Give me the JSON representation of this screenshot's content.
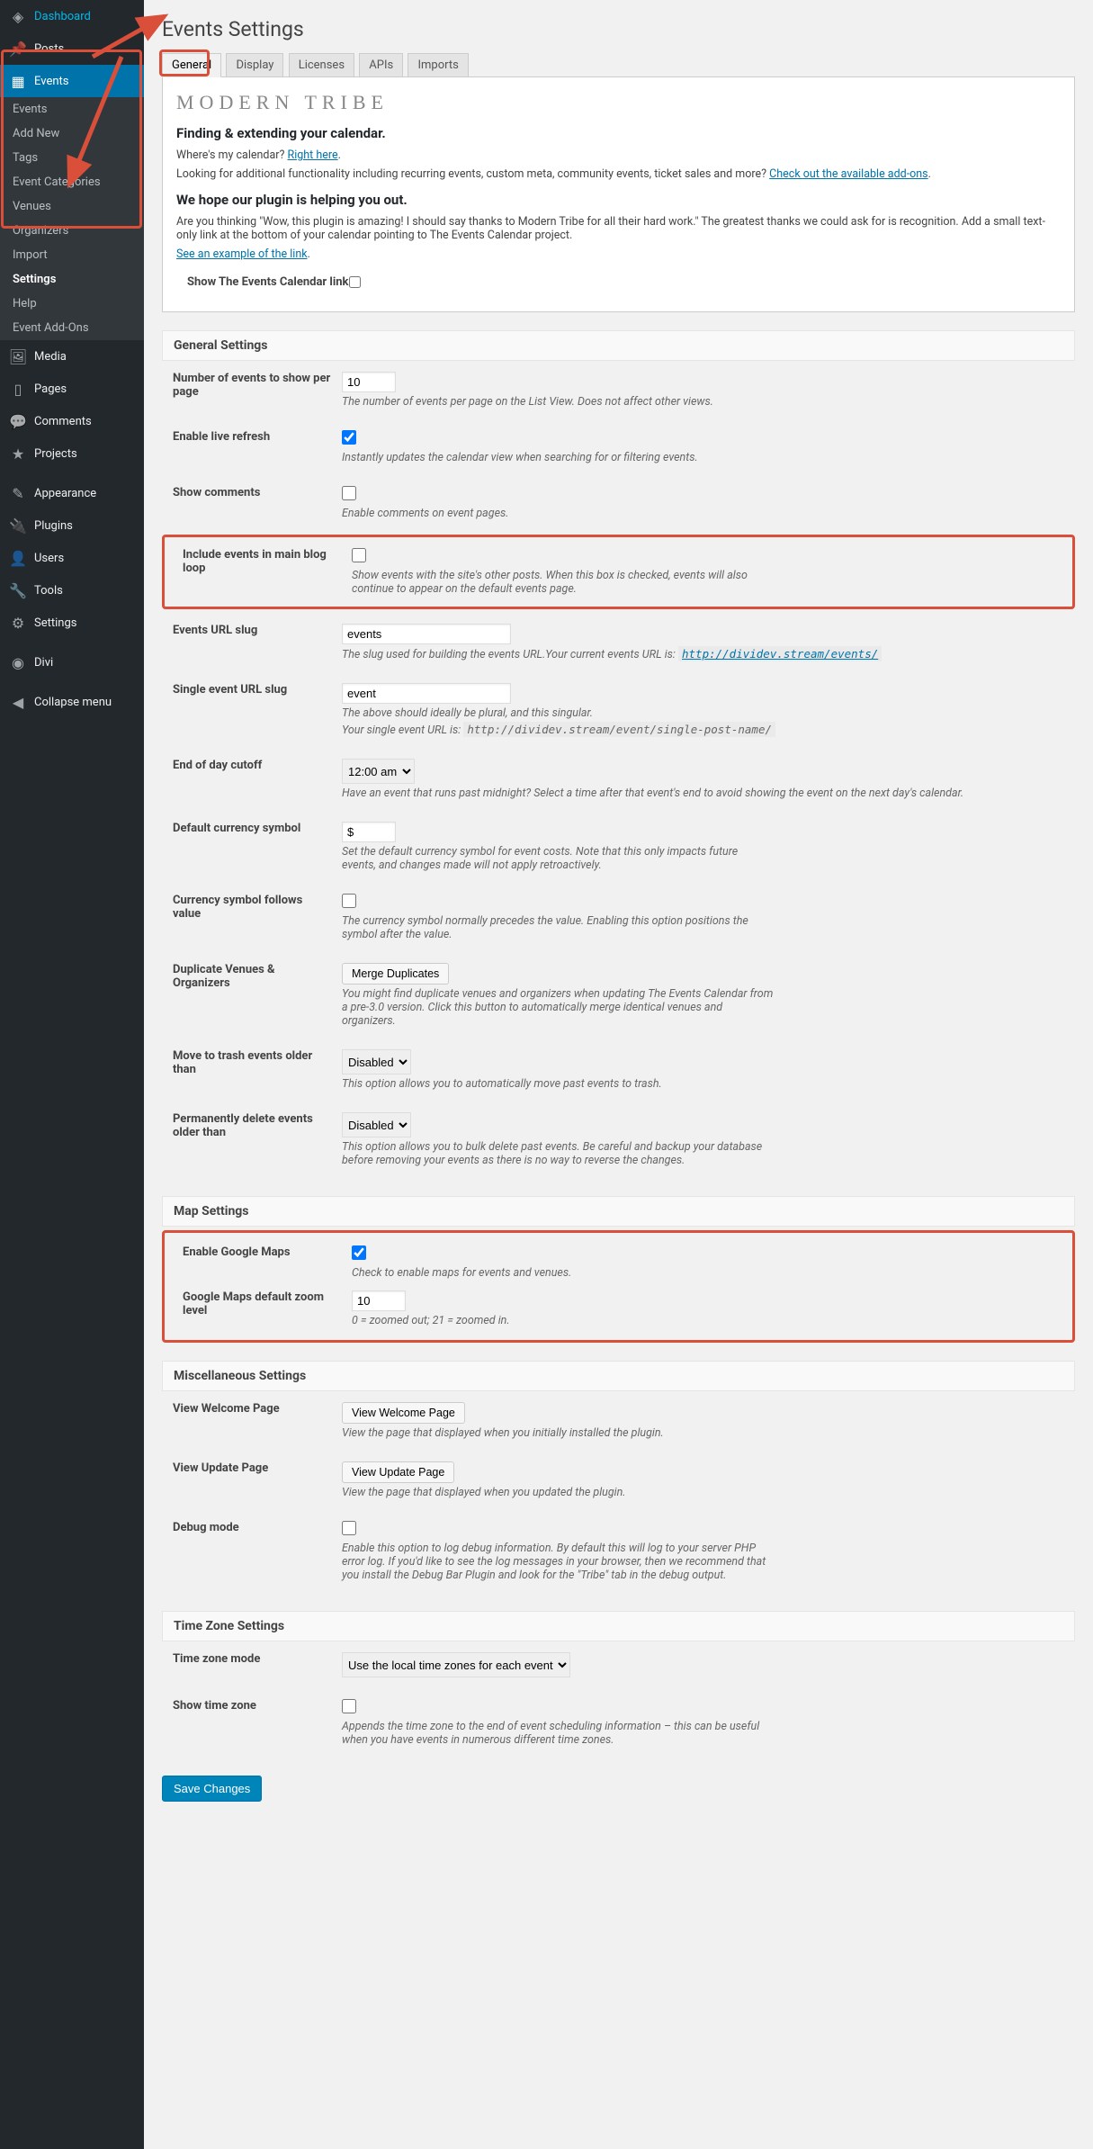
{
  "sidebar": {
    "items": [
      {
        "label": "Dashboard",
        "icon": "◈"
      },
      {
        "label": "Posts",
        "icon": "📌"
      },
      {
        "label": "Events",
        "icon": "▦",
        "active": true
      },
      {
        "label": "Media",
        "icon": "🖼"
      },
      {
        "label": "Pages",
        "icon": "▯"
      },
      {
        "label": "Comments",
        "icon": "💬"
      },
      {
        "label": "Projects",
        "icon": "★"
      },
      {
        "label": "Appearance",
        "icon": "✎"
      },
      {
        "label": "Plugins",
        "icon": "🔌"
      },
      {
        "label": "Users",
        "icon": "👤"
      },
      {
        "label": "Tools",
        "icon": "🔧"
      },
      {
        "label": "Settings",
        "icon": "⚙"
      },
      {
        "label": "Divi",
        "icon": "◉"
      },
      {
        "label": "Collapse menu",
        "icon": "◀"
      }
    ],
    "submenu": [
      "Events",
      "Add New",
      "Tags",
      "Event Categories",
      "Venues",
      "Organizers",
      "Import",
      "Settings",
      "Help",
      "Event Add-Ons"
    ]
  },
  "page_title": "Events Settings",
  "tabs": [
    "General",
    "Display",
    "Licenses",
    "APIs",
    "Imports"
  ],
  "logo": "MODERN TRIBE",
  "intro": {
    "h1": "Finding & extending your calendar.",
    "where_label": "Where's my calendar?",
    "where_link": "Right here",
    "looking": "Looking for additional functionality including recurring events, custom meta, community events, ticket sales and more?",
    "addons_link": "Check out the available add-ons",
    "h2": "We hope our plugin is helping you out.",
    "thank": "Are you thinking \"Wow, this plugin is amazing! I should say thanks to Modern Tribe for all their hard work.\" The greatest thanks we could ask for is recognition. Add a small text-only link at the bottom of your calendar pointing to The Events Calendar project.",
    "see_example": "See an example of the link",
    "show_link_label": "Show The Events Calendar link"
  },
  "sections": {
    "general": "General Settings",
    "map": "Map Settings",
    "misc": "Miscellaneous Settings",
    "tz": "Time Zone Settings"
  },
  "general": {
    "num_events": {
      "label": "Number of events to show per page",
      "value": "10",
      "desc": "The number of events per page on the List View. Does not affect other views."
    },
    "live_refresh": {
      "label": "Enable live refresh",
      "checked": true,
      "desc": "Instantly updates the calendar view when searching for or filtering events."
    },
    "show_comments": {
      "label": "Show comments",
      "checked": false,
      "desc": "Enable comments on event pages."
    },
    "blog_loop": {
      "label": "Include events in main blog loop",
      "checked": false,
      "desc": "Show events with the site's other posts. When this box is checked, events will also continue to appear on the default events page."
    },
    "url_slug": {
      "label": "Events URL slug",
      "value": "events",
      "desc": "The slug used for building the events URL.Your current events URL is:",
      "url": "http://dividev.stream/events/"
    },
    "single_slug": {
      "label": "Single event URL slug",
      "value": "event",
      "desc1": "The above should ideally be plural, and this singular.",
      "desc2": "Your single event URL is:",
      "url": "http://dividev.stream/event/single-post-name/"
    },
    "eod": {
      "label": "End of day cutoff",
      "value": "12:00 am",
      "desc": "Have an event that runs past midnight? Select a time after that event's end to avoid showing the event on the next day's calendar."
    },
    "currency": {
      "label": "Default currency symbol",
      "value": "$",
      "desc": "Set the default currency symbol for event costs. Note that this only impacts future events, and changes made will not apply retroactively."
    },
    "currency_follows": {
      "label": "Currency symbol follows value",
      "checked": false,
      "desc": "The currency symbol normally precedes the value. Enabling this option positions the symbol after the value."
    },
    "duplicates": {
      "label": "Duplicate Venues & Organizers",
      "button": "Merge Duplicates",
      "desc": "You might find duplicate venues and organizers when updating The Events Calendar from a pre-3.0 version. Click this button to automatically merge identical venues and organizers."
    },
    "trash": {
      "label": "Move to trash events older than",
      "value": "Disabled",
      "desc": "This option allows you to automatically move past events to trash."
    },
    "delete": {
      "label": "Permanently delete events older than",
      "value": "Disabled",
      "desc": "This option allows you to bulk delete past events. Be careful and backup your database before removing your events as there is no way to reverse the changes."
    }
  },
  "map": {
    "enable": {
      "label": "Enable Google Maps",
      "checked": true,
      "desc": "Check to enable maps for events and venues."
    },
    "zoom": {
      "label": "Google Maps default zoom level",
      "value": "10",
      "desc": "0 = zoomed out; 21 = zoomed in."
    }
  },
  "misc": {
    "welcome": {
      "label": "View Welcome Page",
      "button": "View Welcome Page",
      "desc": "View the page that displayed when you initially installed the plugin."
    },
    "update": {
      "label": "View Update Page",
      "button": "View Update Page",
      "desc": "View the page that displayed when you updated the plugin."
    },
    "debug": {
      "label": "Debug mode",
      "checked": false,
      "desc1": "Enable this option to log debug information. By default this will log to your server PHP error log. If you'd like to see the log messages in your browser, then we recommend that you install the",
      "link": "Debug Bar Plugin",
      "desc2": "and look for the \"Tribe\" tab in the debug output."
    }
  },
  "tz": {
    "mode": {
      "label": "Time zone mode",
      "value": "Use the local time zones for each event"
    },
    "show": {
      "label": "Show time zone",
      "checked": false,
      "desc": "Appends the time zone to the end of event scheduling information – this can be useful when you have events in numerous different time zones."
    }
  },
  "save": "Save Changes"
}
